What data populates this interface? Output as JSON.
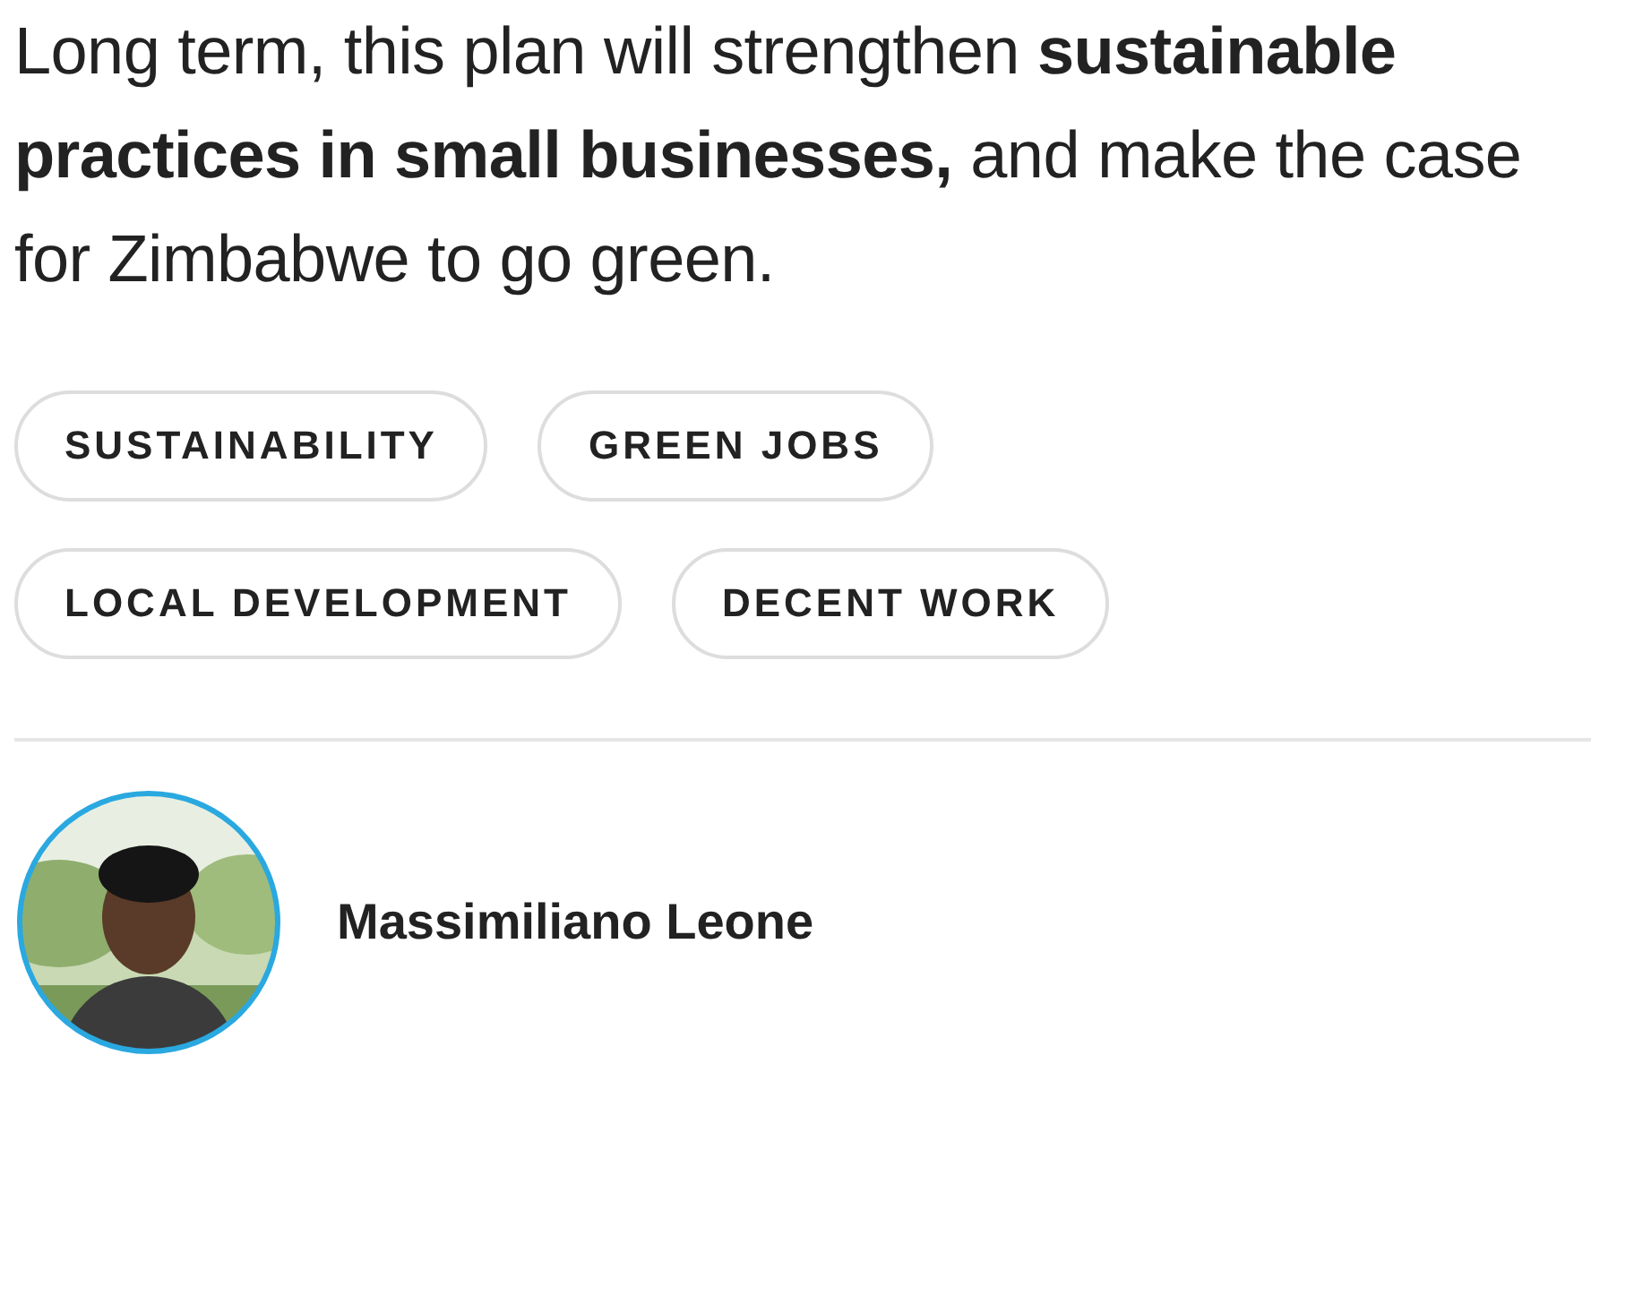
{
  "article": {
    "paragraph": "Long term, this plan will strengthen **sustainable practices in small businesses,** and make the case for Zimbabwe to go green."
  },
  "tags": [
    {
      "label": "SUSTAINABILITY"
    },
    {
      "label": "GREEN JOBS"
    },
    {
      "label": "LOCAL DEVELOPMENT"
    },
    {
      "label": "DECENT WORK"
    }
  ],
  "author": {
    "name": "Massimiliano Leone"
  }
}
